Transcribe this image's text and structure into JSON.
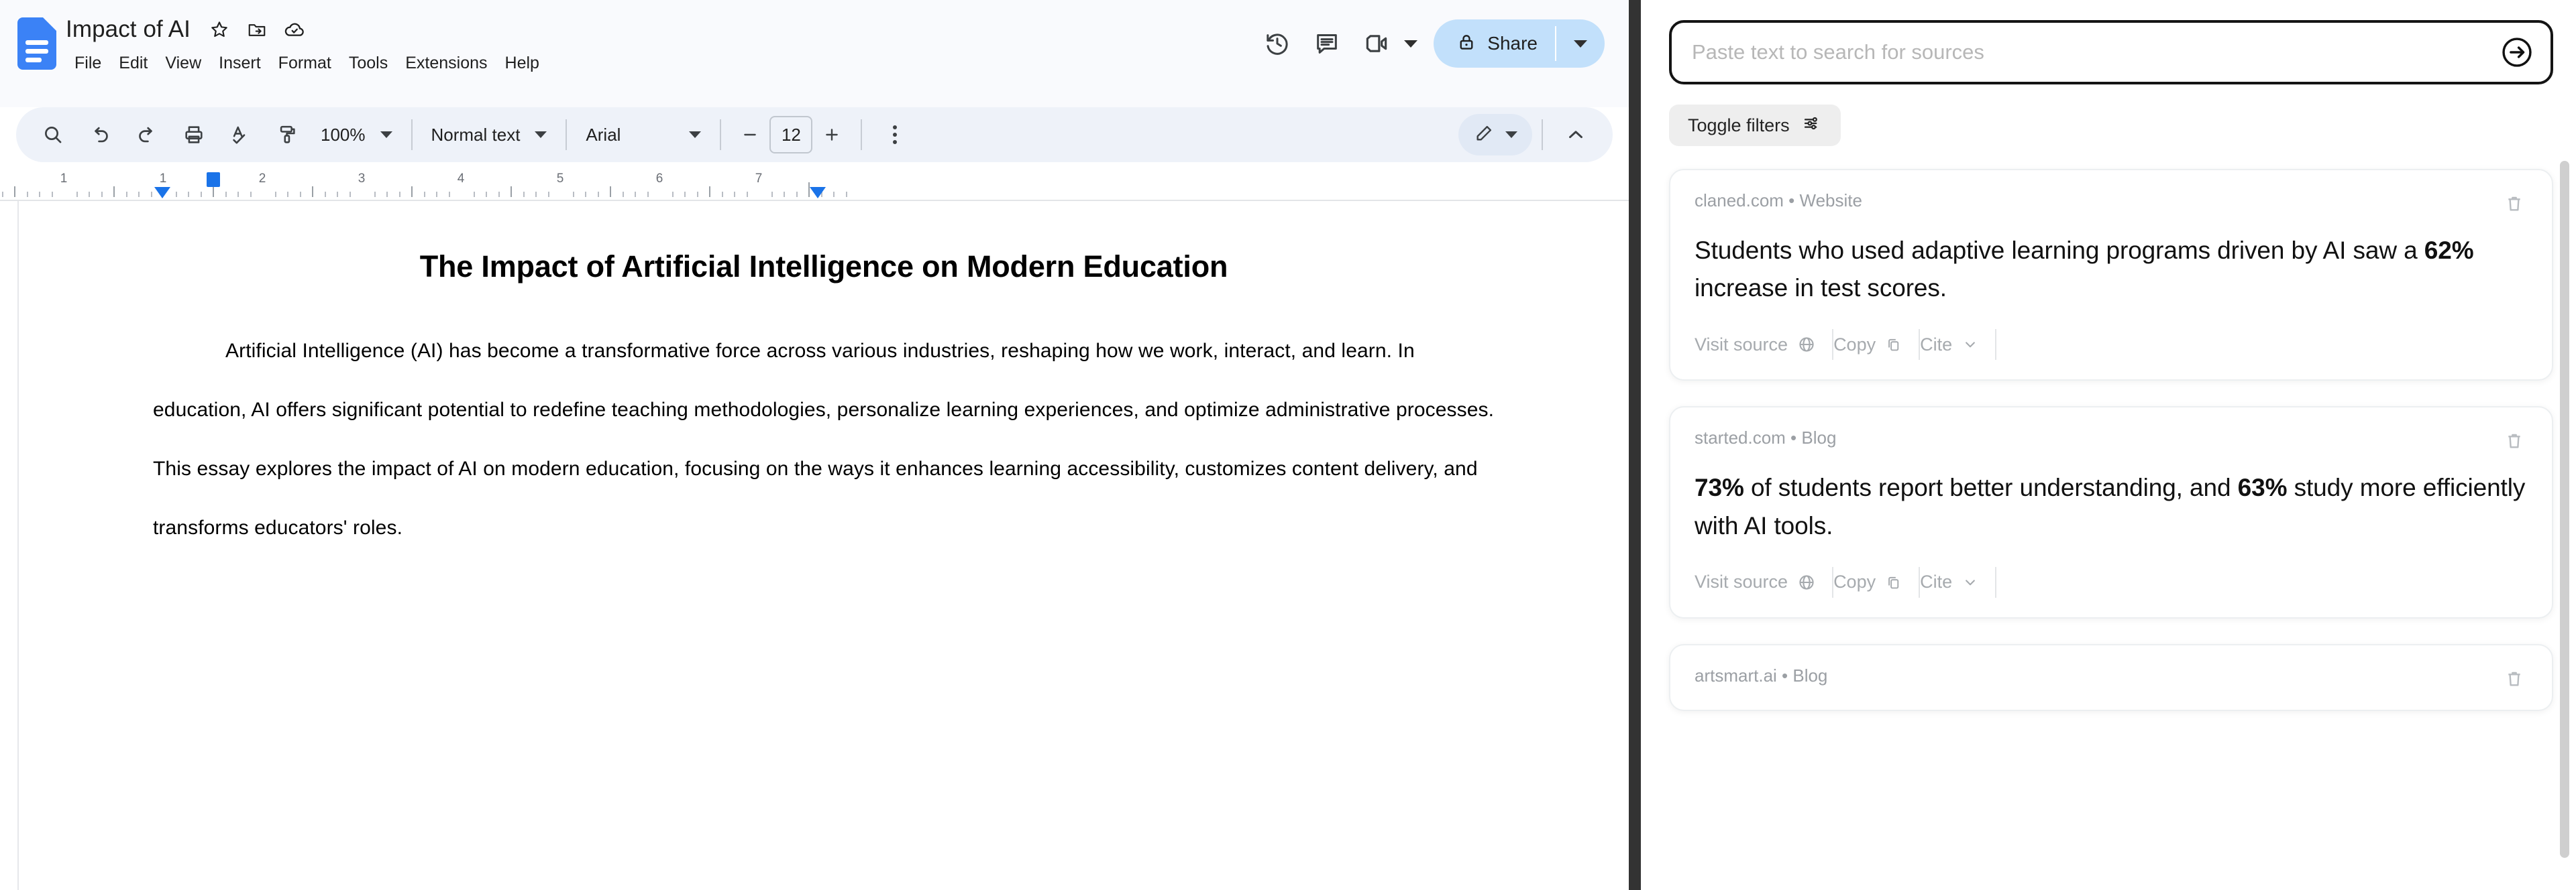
{
  "docs": {
    "logo_icon": "google-docs-icon",
    "title": "Impact of AI",
    "title_icons": [
      {
        "name": "star-icon",
        "label": "Star"
      },
      {
        "name": "move-to-folder-icon",
        "label": "Move"
      },
      {
        "name": "cloud-saved-icon",
        "label": "Saved to Drive"
      }
    ],
    "menu": [
      {
        "label": "File"
      },
      {
        "label": "Edit"
      },
      {
        "label": "View"
      },
      {
        "label": "Insert"
      },
      {
        "label": "Format"
      },
      {
        "label": "Tools"
      },
      {
        "label": "Extensions"
      },
      {
        "label": "Help"
      }
    ],
    "header_actions": [
      {
        "name": "version-history-icon",
        "label": "Version history"
      },
      {
        "name": "comment-icon",
        "label": "Open comment history"
      },
      {
        "name": "meet-camera-icon",
        "label": "Join a call"
      }
    ],
    "share": {
      "label": "Share",
      "lock_icon": "lock-icon",
      "dropdown_icon": "caret-down-icon",
      "bg_color": "#c2e0fb"
    },
    "toolbar": {
      "left_icons": [
        {
          "name": "search-icon",
          "label": "Search the menus"
        },
        {
          "name": "undo-icon",
          "label": "Undo"
        },
        {
          "name": "redo-icon",
          "label": "Redo"
        },
        {
          "name": "print-icon",
          "label": "Print"
        },
        {
          "name": "spellcheck-icon",
          "label": "Spelling and grammar check"
        },
        {
          "name": "paint-format-icon",
          "label": "Paint format"
        }
      ],
      "zoom": "100%",
      "paragraph_style": "Normal text",
      "font_family": "Arial",
      "font_size": "12",
      "decrease_font_label": "−",
      "increase_font_label": "+",
      "more_icon": "kebab-more-icon",
      "edit_mode_icon": "pencil-edit-icon",
      "collapse_icon": "chevron-up-icon"
    },
    "ruler": {
      "numbers": [
        "1",
        "1",
        "2",
        "3",
        "4",
        "5",
        "6",
        "7"
      ],
      "left_indent_marker": "first-line-indent-marker",
      "left_margin_marker": "left-indent-marker",
      "right_indent_marker": "right-indent-marker"
    },
    "document": {
      "heading": "The Impact of Artificial Intelligence on Modern Education",
      "paragraph": "Artificial Intelligence (AI) has become a transformative force across various industries, reshaping how we work, interact, and learn. In education, AI offers significant potential to redefine teaching methodologies, personalize learning experiences, and optimize administrative processes. This essay explores the impact of AI on modern education, focusing on the ways it enhances learning accessibility, customizes content delivery, and transforms educators' roles."
    }
  },
  "panel": {
    "search": {
      "value": "",
      "placeholder": "Paste text to search for sources",
      "submit_icon": "arrow-right-circle-icon"
    },
    "filters": {
      "label": "Toggle filters",
      "icon": "sliders-filter-icon"
    },
    "action_labels": {
      "visit": "Visit source",
      "visit_icon": "globe-icon",
      "copy": "Copy",
      "copy_icon": "copy-icon",
      "cite": "Cite",
      "cite_icon": "chevron-down-icon",
      "delete_icon": "trash-icon"
    },
    "cards": [
      {
        "source": "claned.com • Website",
        "quote_parts": [
          {
            "text": "Students who used adaptive learning programs driven by AI saw a ",
            "bold": false
          },
          {
            "text": "62%",
            "bold": true
          },
          {
            "text": " increase in test scores.",
            "bold": false
          }
        ]
      },
      {
        "source": "started.com • Blog",
        "quote_parts": [
          {
            "text": "73%",
            "bold": true
          },
          {
            "text": " of students report better understanding, and ",
            "bold": false
          },
          {
            "text": "63%",
            "bold": true
          },
          {
            "text": " study more efficiently with AI tools.",
            "bold": false
          }
        ]
      },
      {
        "source": "artsmart.ai • Blog",
        "quote_parts": []
      }
    ]
  }
}
